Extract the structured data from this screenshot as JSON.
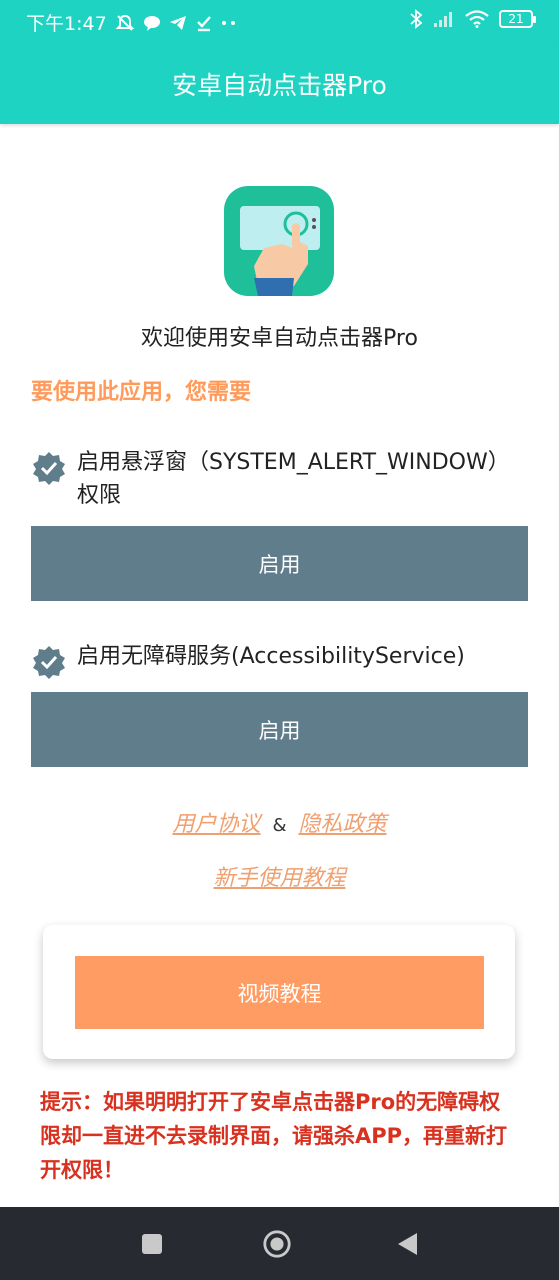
{
  "status_bar": {
    "time": "下午1:47",
    "battery": "21",
    "left_icons": [
      "mute-bell-icon",
      "chat-bubble-icon",
      "telegram-icon",
      "download-check-icon",
      "more-dots-icon"
    ],
    "right_icons": [
      "bluetooth-icon",
      "signal-icon",
      "wifi-icon",
      "battery-icon"
    ]
  },
  "app_bar": {
    "title": "安卓自动点击器Pro"
  },
  "welcome": "欢迎使用安卓自动点击器Pro",
  "requirement": "要使用此应用，您需要",
  "permissions": [
    {
      "label": "启用悬浮窗（SYSTEM_ALERT_WINDOW）权限",
      "button": "启用"
    },
    {
      "label": "启用无障碍服务(AccessibilityService)",
      "button": "启用"
    }
  ],
  "links": {
    "user_agreement": "用户协议",
    "separator": "&",
    "privacy_policy": "隐私政策",
    "tutorial": "新手使用教程"
  },
  "video_button": "视频教程",
  "hint": "提示：如果明明打开了安卓点击器Pro的无障碍权限却一直进不去录制界面，请强杀APP，再重新打开权限！",
  "colors": {
    "accent": "#1fd3c2",
    "button": "#607d8b",
    "orange": "#ff9c64",
    "hint": "#d9311f",
    "nav": "#272a31"
  }
}
